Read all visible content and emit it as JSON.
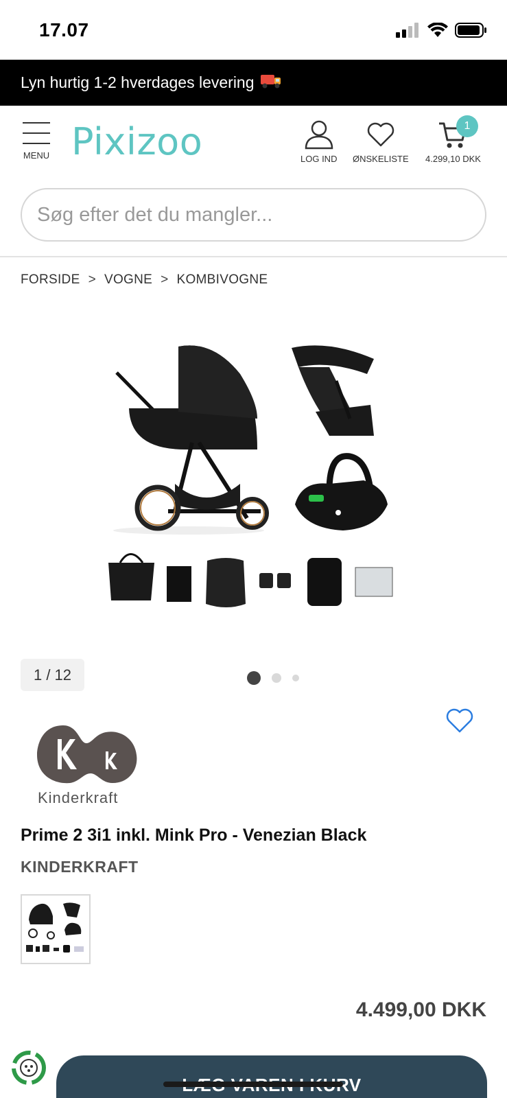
{
  "status_bar": {
    "time": "17.07"
  },
  "promo": {
    "text": "Lyn hurtig 1-2 hverdages levering"
  },
  "header": {
    "menu_label": "MENU",
    "logo_text": "Pixizoo",
    "login_label": "LOG IND",
    "wishlist_label": "ØNSKELISTE",
    "cart_total": "4.299,10 DKK",
    "cart_count": "1"
  },
  "search": {
    "placeholder": "Søg efter det du mangler..."
  },
  "breadcrumb": {
    "items": [
      "FORSIDE",
      "VOGNE",
      "KOMBIVOGNE"
    ],
    "separator": ">"
  },
  "gallery": {
    "counter": "1 / 12",
    "dots_count": 3,
    "active_dot": 1
  },
  "product": {
    "brand_logo_text": "Kinderkraft",
    "title": "Prime 2 3i1 inkl. Mink Pro - Venezian Black",
    "brand": "KINDERKRAFT",
    "price": "4.499,00 DKK",
    "add_to_cart_label": "LÆG VAREN I KURV"
  },
  "colors": {
    "accent": "#5ec5c2",
    "button": "#2f4858",
    "wish_heart": "#2b7de0"
  }
}
